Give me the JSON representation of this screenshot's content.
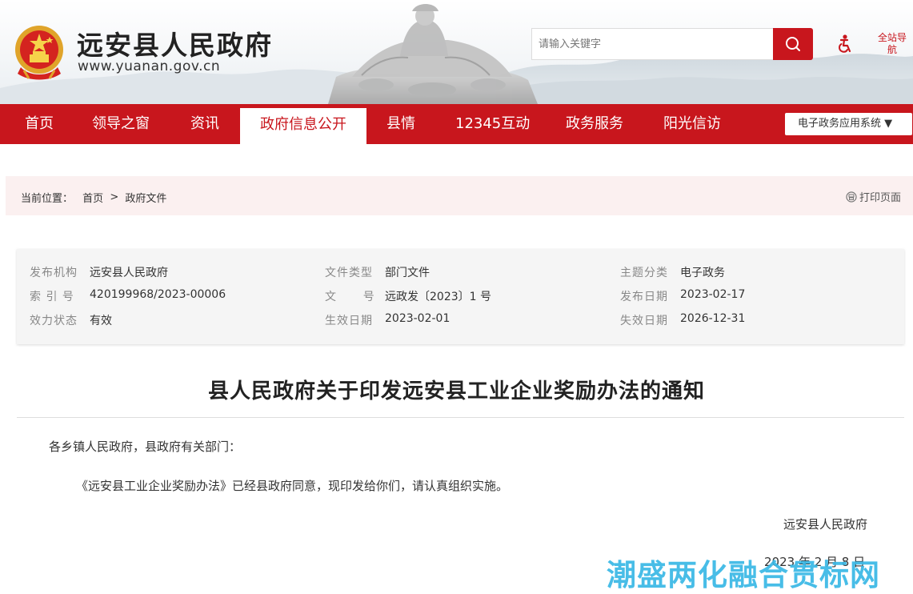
{
  "header": {
    "site_title": "远安县人民政府",
    "site_url": "www.yuanan.gov.cn",
    "search_placeholder": "请输入关键字",
    "full_nav": "全站导航"
  },
  "nav": {
    "items": [
      "首页",
      "领导之窗",
      "资讯",
      "政府信息公开",
      "县情",
      "12345互动",
      "政务服务",
      "阳光信访"
    ],
    "active": "政府信息公开",
    "eapp_label": "电子政务应用系统 ▼"
  },
  "breadcrumb": {
    "prefix": "当前位置：",
    "home": "首页",
    "sep": ">",
    "current": "政府文件",
    "print": "打印页面"
  },
  "meta": {
    "rows": [
      [
        {
          "label": "发布机构",
          "value": "远安县人民政府"
        },
        {
          "label": "文件类型",
          "value": "部门文件"
        },
        {
          "label": "主题分类",
          "value": "电子政务"
        }
      ],
      [
        {
          "label": "索 引 号",
          "value": "420199968/2023-00006"
        },
        {
          "label": "文      号",
          "value": "远政发〔2023〕1 号"
        },
        {
          "label": "发布日期",
          "value": "2023-02-17"
        }
      ],
      [
        {
          "label": "效力状态",
          "value": "有效"
        },
        {
          "label": "生效日期",
          "value": "2023-02-01"
        },
        {
          "label": "失效日期",
          "value": "2026-12-31"
        }
      ]
    ]
  },
  "article": {
    "title": "县人民政府关于印发远安县工业企业奖励办法的通知",
    "salutation": "各乡镇人民政府，县政府有关部门：",
    "body": "《远安县工业企业奖励办法》已经县政府同意，现印发给你们，请认真组织实施。",
    "signature": "远安县人民政府",
    "date": "2023 年 2 月 8 日"
  },
  "watermark": "潮盛两化融合贯标网",
  "colors": {
    "brand_red": "#c8161d",
    "breadcrumb_bg": "#fbf0f0",
    "meta_bg": "#f5f5f5",
    "watermark": "#39b8e6"
  }
}
